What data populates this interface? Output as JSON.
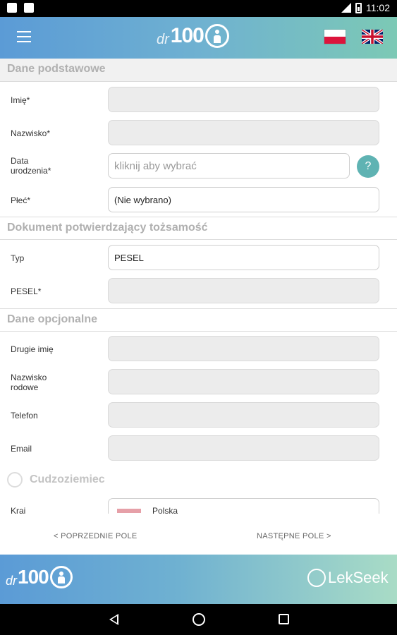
{
  "status_bar": {
    "time": "11:02"
  },
  "header": {
    "logo": {
      "prefix": "dr",
      "number": "100"
    },
    "languages": [
      "polish-flag",
      "uk-flag"
    ]
  },
  "form": {
    "sections": {
      "basic": "Dane podstawowe",
      "identity": "Dokument potwierdzający tożsamość",
      "optional": "Dane opcjonalne"
    },
    "first_name": {
      "label": "Imię*",
      "value": ""
    },
    "last_name": {
      "label": "Nazwisko*",
      "value": ""
    },
    "birth_date": {
      "label_line1": "Data",
      "label_line2": "urodzenia*",
      "placeholder": "kliknij aby wybrać",
      "help": "?"
    },
    "gender": {
      "label": "Płeć*",
      "value": "(Nie wybrano)"
    },
    "doc_type": {
      "label": "Typ",
      "value": "PESEL"
    },
    "pesel": {
      "label": "PESEL*",
      "value": ""
    },
    "middle_name": {
      "label": "Drugie imię",
      "value": ""
    },
    "maiden_name": {
      "label_line1": "Nazwisko",
      "label_line2": "rodowe",
      "value": ""
    },
    "phone": {
      "label": "Telefon",
      "value": ""
    },
    "email": {
      "label": "Email",
      "value": ""
    },
    "foreigner": {
      "label": "Cudzoziemiec",
      "checked": false
    },
    "country": {
      "label": "Kraj",
      "value": "Polska"
    }
  },
  "navigation": {
    "prev": "< POPRZEDNIE POLE",
    "next": "NASTĘPNE POLE >"
  },
  "footer": {
    "logo": {
      "prefix": "dr",
      "number": "100"
    },
    "partner": "LekSeek"
  }
}
